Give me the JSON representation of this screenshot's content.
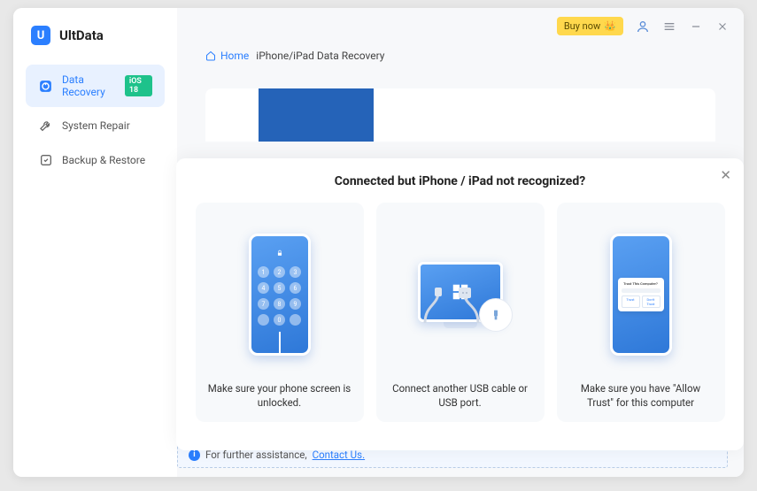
{
  "app_name": "UltData",
  "titlebar": {
    "buy_label": "Buy now"
  },
  "sidebar": {
    "items": [
      {
        "label": "Data Recovery",
        "badge": "iOS 18"
      },
      {
        "label": "System Repair"
      },
      {
        "label": "Backup & Restore"
      }
    ]
  },
  "breadcrumb": {
    "home": "Home",
    "current": "iPhone/iPad Data Recovery"
  },
  "modal": {
    "title": "Connected but iPhone / iPad not recognized?",
    "cards": [
      {
        "caption": "Make sure your phone screen is unlocked."
      },
      {
        "caption": "Connect another USB cable or USB port."
      },
      {
        "caption": "Make sure you have \"Allow Trust\" for this computer"
      }
    ],
    "dialog": {
      "title": "Trust This Computer?",
      "trust": "Trust",
      "dont": "Don't Trust"
    }
  },
  "footer": {
    "text": "For further assistance, ",
    "link": "Contact Us."
  }
}
